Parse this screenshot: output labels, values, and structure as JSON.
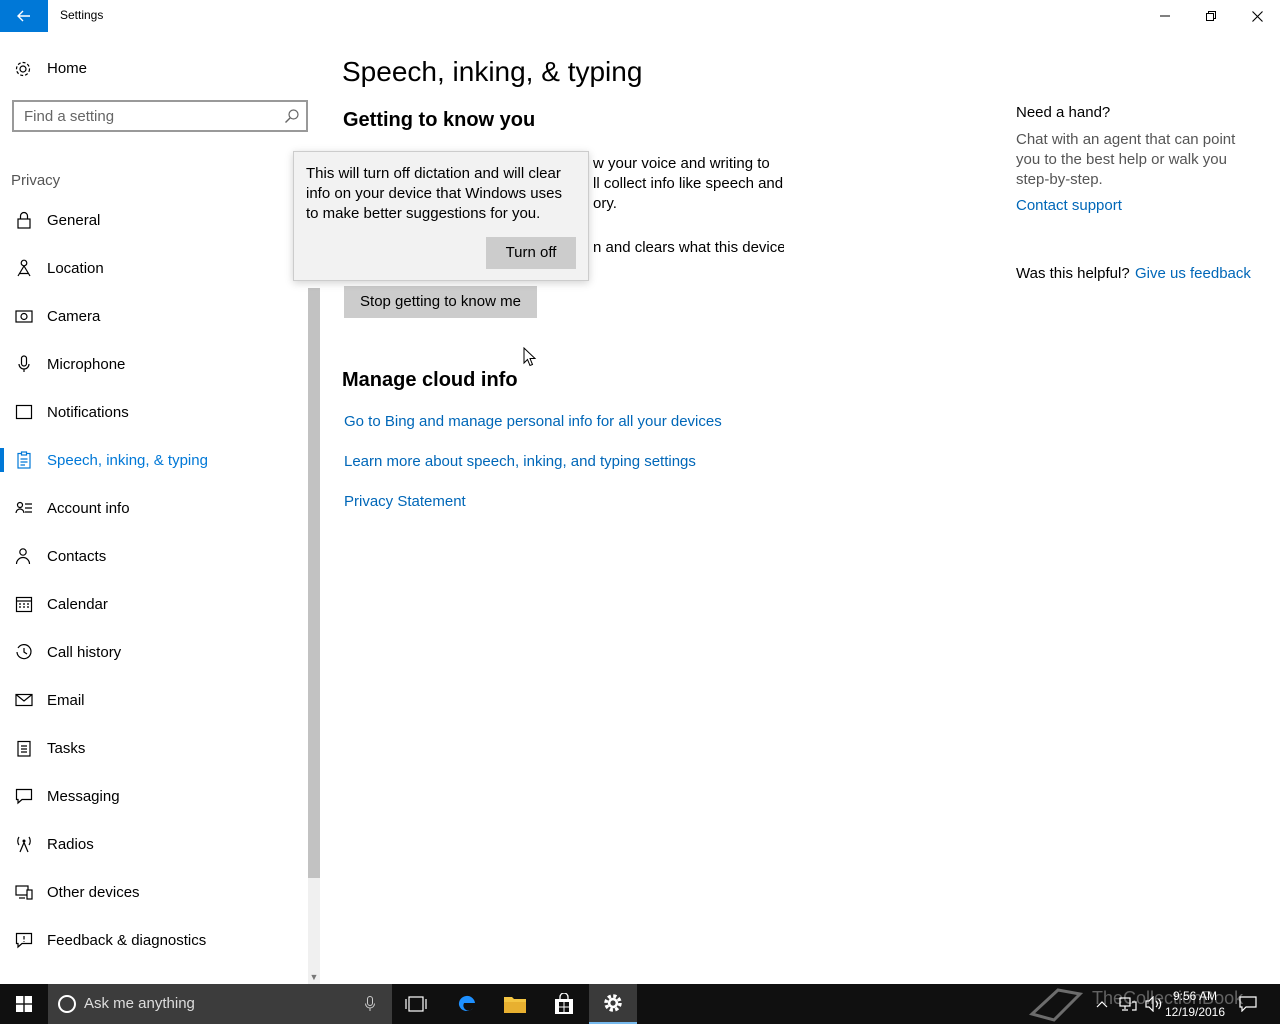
{
  "window": {
    "title": "Settings"
  },
  "sidebar": {
    "home_label": "Home",
    "search_placeholder": "Find a setting",
    "section_label": "Privacy",
    "items": [
      {
        "label": "General",
        "icon": "lock-icon"
      },
      {
        "label": "Location",
        "icon": "location-person-icon"
      },
      {
        "label": "Camera",
        "icon": "camera-icon"
      },
      {
        "label": "Microphone",
        "icon": "microphone-icon"
      },
      {
        "label": "Notifications",
        "icon": "message-icon"
      },
      {
        "label": "Speech, inking, & typing",
        "icon": "clipboard-icon",
        "active": true
      },
      {
        "label": "Account info",
        "icon": "contact-card-icon"
      },
      {
        "label": "Contacts",
        "icon": "people-icon"
      },
      {
        "label": "Calendar",
        "icon": "calendar-icon"
      },
      {
        "label": "Call history",
        "icon": "history-icon"
      },
      {
        "label": "Email",
        "icon": "mail-icon"
      },
      {
        "label": "Tasks",
        "icon": "tasks-icon"
      },
      {
        "label": "Messaging",
        "icon": "chat-icon"
      },
      {
        "label": "Radios",
        "icon": "radio-tower-icon"
      },
      {
        "label": "Other devices",
        "icon": "devices-icon"
      },
      {
        "label": "Feedback & diagnostics",
        "icon": "feedback-icon"
      }
    ]
  },
  "main": {
    "page_title": "Speech, inking, & typing",
    "subheading": "Getting to know you",
    "para_1_line_1": "w your voice and writing to",
    "para_1_line_2": "ll collect info like speech and",
    "para_1_line_3": "ory.",
    "para_2_line_1": "n and clears what this device",
    "stop_button": "Stop getting to know me",
    "cloud_heading": "Manage cloud info",
    "links": [
      "Go to Bing and manage personal info for all your devices",
      "Learn more about speech, inking, and typing settings",
      "Privacy Statement"
    ]
  },
  "help": {
    "title": "Need a hand?",
    "text": "Chat with an agent that can point you to the best help or walk you step-by-step.",
    "contact_link": "Contact support",
    "helpful_label": "Was this helpful?",
    "feedback_link": "Give us feedback"
  },
  "flyout": {
    "text": "This will turn off dictation and will clear info on your device that Windows uses to make better suggestions for you.",
    "button": "Turn off"
  },
  "taskbar": {
    "search_placeholder": "Ask me anything",
    "time": "9:56 AM",
    "date": "12/19/2016",
    "watermark": "TheCollectionBook"
  },
  "colors": {
    "accent": "#0078d7",
    "link": "#0067b8",
    "taskbar": "#101010"
  }
}
